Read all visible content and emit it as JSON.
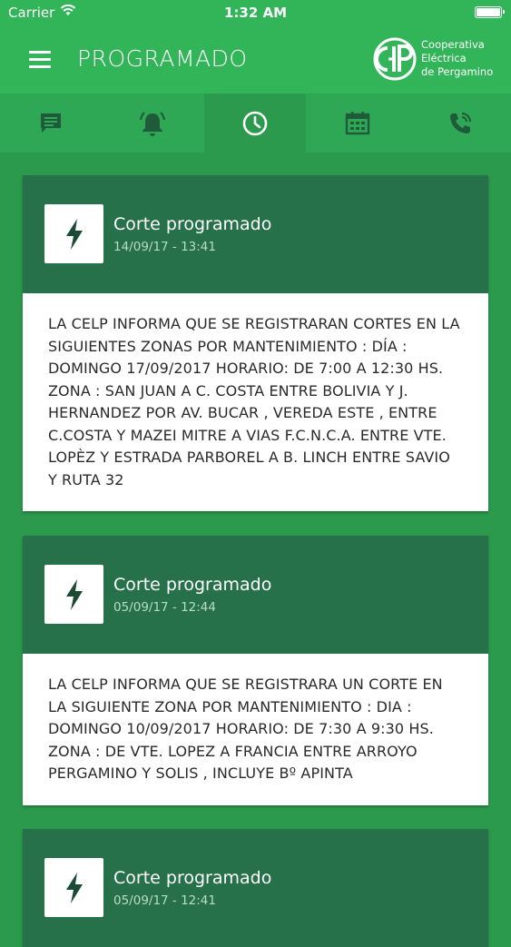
{
  "status_bar": {
    "carrier": "Carrier",
    "time": "1:32 AM"
  },
  "header": {
    "title": "PROGRAMADO",
    "logo_lines": [
      "Cooperativa",
      "Eléctrica",
      "de Pergamino"
    ]
  },
  "tabs": [
    {
      "icon": "message-icon"
    },
    {
      "icon": "alarm-icon"
    },
    {
      "icon": "clock-icon",
      "active": true
    },
    {
      "icon": "calendar-icon"
    },
    {
      "icon": "phone-icon"
    }
  ],
  "notices": [
    {
      "icon": "bolt-icon",
      "title": "Corte programado",
      "date": "14/09/17 - 13:41",
      "body": "LA CELP INFORMA QUE SE REGISTRARAN CORTES EN LA\nSIGUIENTES ZONAS POR MANTENIMIENTO : DÍA :\nDOMINGO 17/09/2017 HORARIO: DE 7:00 A 12:30 HS.\nZONA : SAN JUAN A C. COSTA ENTRE BOLIVIA Y J.\nHERNANDEZ POR AV. BUCAR , VEREDA ESTE , ENTRE\nC.COSTA Y MAZEI MITRE A VIAS F.C.N.C.A. ENTRE VTE.\nLOPÈZ Y ESTRADA PARBOREL A B. LINCH ENTRE SAVIO\nY RUTA 32"
    },
    {
      "icon": "bolt-icon",
      "title": "Corte programado",
      "date": "05/09/17 - 12:44",
      "body": "LA CELP INFORMA QUE SE REGISTRARA UN CORTE EN\nLA SIGUIENTE ZONA POR MANTENIMIENTO : DIA :\nDOMINGO 10/09/2017 HORARIO: DE 7:30 A 9:30 HS.\nZONA : DE VTE. LOPEZ A FRANCIA ENTRE ARROYO\nPERGAMINO Y SOLIS , INCLUYE Bº APINTA"
    },
    {
      "icon": "bolt-icon",
      "title": "Corte programado",
      "date": "05/09/17 - 12:41",
      "body": ""
    }
  ],
  "colors": {
    "header": "#32b558",
    "background": "#2b9a4c",
    "card_header": "#26704a"
  }
}
